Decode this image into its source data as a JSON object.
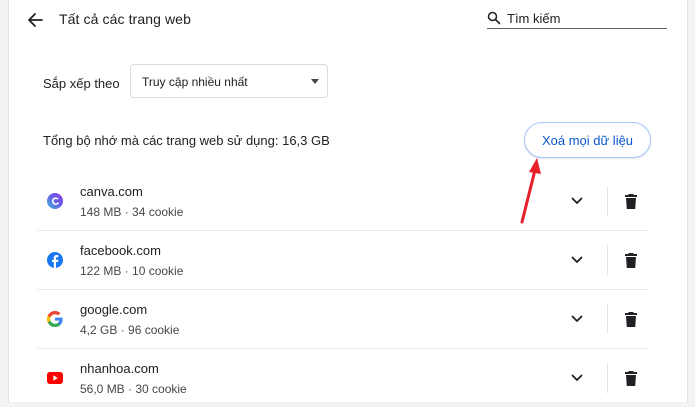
{
  "header": {
    "title": "Tất cả các trang web",
    "back_icon": "arrow-back-icon",
    "search": {
      "icon": "search-icon",
      "placeholder": "Tìm kiếm",
      "value": ""
    }
  },
  "sort": {
    "label": "Sắp xếp theo",
    "selected": "Truy cập nhiều nhất",
    "arrow_icon": "triangle-down-icon"
  },
  "storage": {
    "text": "Tổng bộ nhớ mà các trang web sử dụng: 16,3 GB",
    "clear_all_label": "Xoá mọi dữ liệu"
  },
  "sites": [
    {
      "name": "canva.com",
      "meta": "148 MB · 34 cookie",
      "favicon": "canva-logo-icon"
    },
    {
      "name": "facebook.com",
      "meta": "122 MB · 10 cookie",
      "favicon": "facebook-logo-icon"
    },
    {
      "name": "google.com",
      "meta": "4,2 GB · 96 cookie",
      "favicon": "google-logo-icon"
    },
    {
      "name": "nhanhoa.com",
      "meta": "56,0 MB · 30 cookie",
      "favicon": "youtube-logo-icon"
    }
  ],
  "row_actions": {
    "expand_icon": "chevron-down-icon",
    "delete_icon": "trash-icon"
  },
  "colors": {
    "accent": "#0b57d0",
    "accent_border": "#a8c7fa",
    "annotation_arrow": "#e8202a",
    "facebook_blue": "#1877f2",
    "youtube_red": "#ff0000"
  }
}
